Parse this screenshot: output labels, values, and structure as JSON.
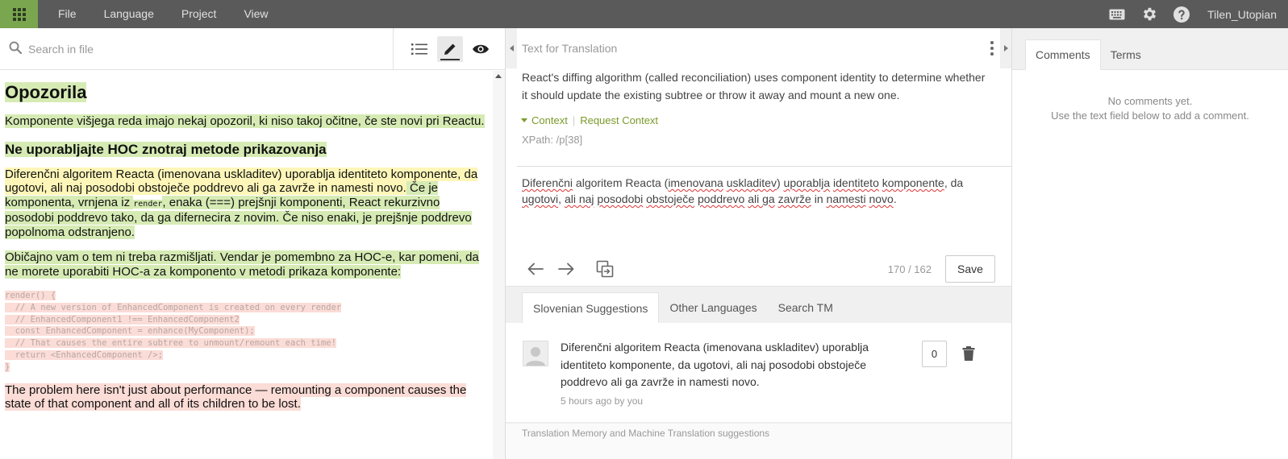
{
  "colors": {
    "topbar": "#5a5a5a",
    "brand_green": "#7aa650",
    "accent_link": "#7a9a2a"
  },
  "menu": {
    "file": "File",
    "language": "Language",
    "project": "Project",
    "view": "View"
  },
  "topbar": {
    "username": "Tilen_Utopian",
    "icons": [
      "keyboard-icon",
      "gear-icon",
      "help-icon"
    ]
  },
  "left": {
    "search_placeholder": "Search in file",
    "doc": {
      "h1": "Opozorila",
      "p1": "Komponente višjega reda imajo nekaj opozoril, ki niso takoj očitne, če ste novi pri Reactu.",
      "h2": "Ne uporabljajte HOC znotraj metode prikazovanja",
      "p2_a": "Diferenčni algoritem Reacta (imenovana uskladitev) uporablja identiteto komponente, da ugotovi, ali naj posodobi obstoječe poddrevo ali ga zavrže in namesti novo.",
      "p2_b": " Če je komponenta, vrnjena iz ",
      "p2_code": "render",
      "p2_c": ", enaka (===) prejšnji komponenti, React rekurzivno posodobi poddrevo tako, da ga difernecira z novim. Če niso enaki, je prejšnje poddrevo popolnoma odstranjeno.",
      "p3": "Običajno vam o tem ni treba razmišljati. Vendar je pomembno za HOC-e, kar pomeni, da ne morete uporabiti HOC-a za komponento v metodi prikaza komponente:",
      "code": "render() {\n  // A new version of EnhancedComponent is created on every render\n  // EnhancedComponent1 !== EnhancedComponent2\n  const EnhancedComponent = enhance(MyComponent);\n  // That causes the entire subtree to unmount/remount each time!\n  return <EnhancedComponent />;\n}",
      "p4": "The problem here isn't just about performance — remounting a component causes the state of that component and all of its children to be lost."
    }
  },
  "center": {
    "header": "Text for Translation",
    "source": "React's diffing algorithm (called reconciliation) uses component identity to determine whether it should update the existing subtree or throw it away and mount a new one.",
    "context_label": "Context",
    "request_context": "Request Context",
    "xpath": "XPath: /p[38]",
    "target": {
      "w1": "Diferenčni",
      "w2": " algoritem ",
      "w3": "Reacta",
      "w4": " (",
      "w5": "imenovana",
      "w6": " ",
      "w7": "uskladitev",
      "w8": ") ",
      "w9": "uporablja",
      "w10": " ",
      "w11": "identiteto",
      "w12": " ",
      "w13": "komponente",
      "w14": ", da ",
      "w15": "ugotovi",
      "w16": ", ",
      "w17": "ali naj",
      "w18": " ",
      "w19": "posodobi",
      "w20": " ",
      "w21": "obstoječe",
      "w22": " ",
      "w23": "poddrevo",
      "w24": " ",
      "w25": "ali ga",
      "w26": " ",
      "w27": "zavrže",
      "w28": " in ",
      "w29": "namesti",
      "w30": " ",
      "w31": "novo",
      "w32": "."
    },
    "counter": "170 / 162",
    "save": "Save",
    "tabs": {
      "slovenian": "Slovenian Suggestions",
      "other": "Other Languages",
      "search_tm": "Search TM"
    },
    "suggestion": {
      "text": "Diferenčni algoritem Reacta (imenovana uskladitev) uporablja identiteto komponente, da ugotovi, ali naj posodobi obstoječe poddrevo ali ga zavrže in namesti novo.",
      "meta": "5 hours ago by you",
      "votes": "0"
    },
    "tm_label": "Translation Memory and Machine Translation suggestions"
  },
  "right": {
    "tab_comments": "Comments",
    "tab_terms": "Terms",
    "no_comments_1": "No comments yet.",
    "no_comments_2": "Use the text field below to add a comment."
  }
}
